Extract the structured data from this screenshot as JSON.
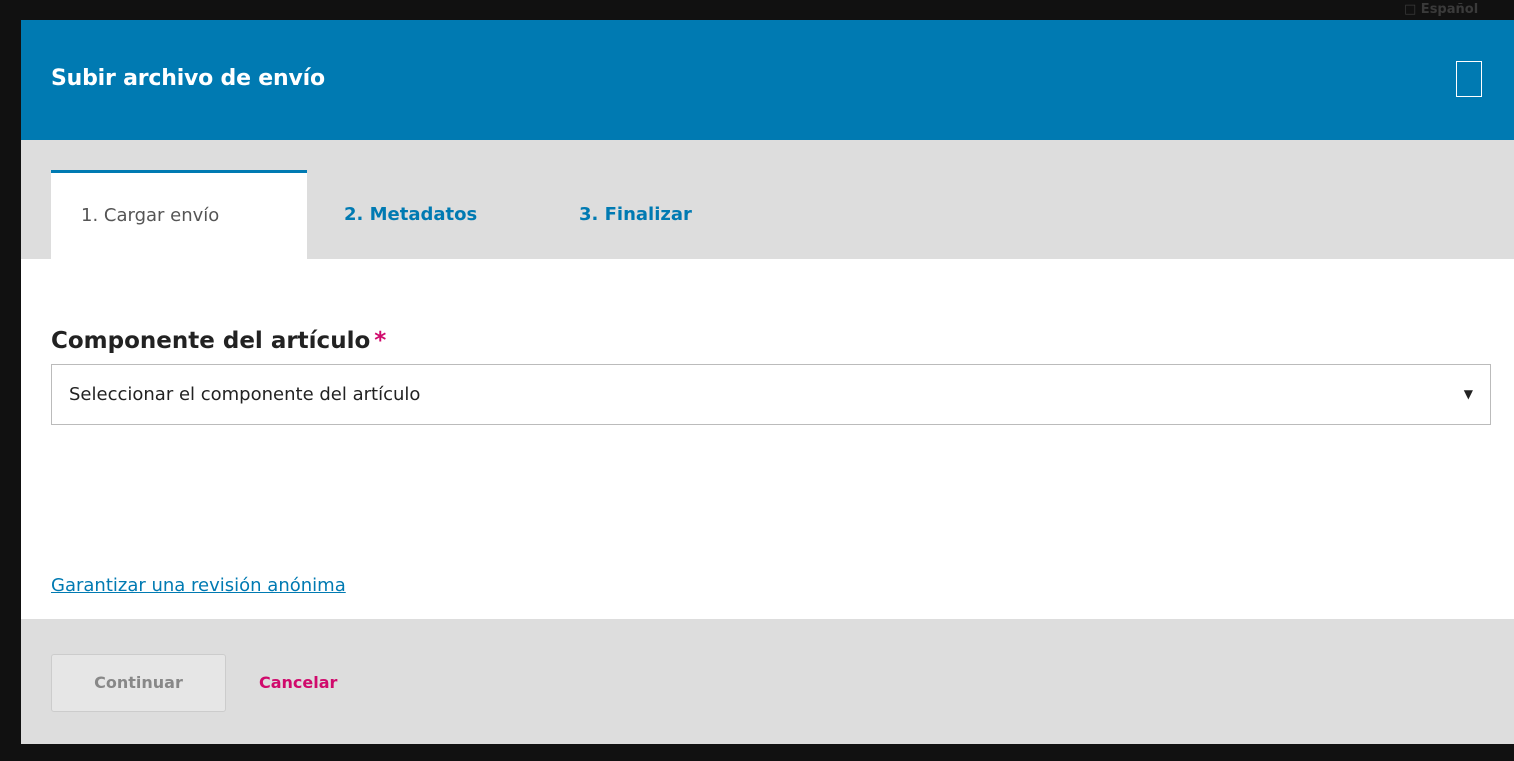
{
  "background": {
    "peek_text": "□ Español"
  },
  "modal": {
    "title": "Subir archivo de envío",
    "close_icon": "square-close-icon"
  },
  "tabs": [
    {
      "label": "1. Cargar envío",
      "active": true
    },
    {
      "label": "2. Metadatos",
      "active": false
    },
    {
      "label": "3. Finalizar",
      "active": false
    }
  ],
  "form": {
    "component_label": "Componente del artículo",
    "required_marker": "*",
    "component_select": {
      "selected": "Seleccionar el componente del artículo",
      "arrow": "▼"
    },
    "anonymous_review_link": "Garantizar una revisión anónima"
  },
  "footer": {
    "continue_label": "Continuar",
    "cancel_label": "Cancelar"
  },
  "colors": {
    "header": "#007ab2",
    "accent_link": "#007ab2",
    "danger": "#d00a6c",
    "tabs_bg": "#dddddd"
  }
}
